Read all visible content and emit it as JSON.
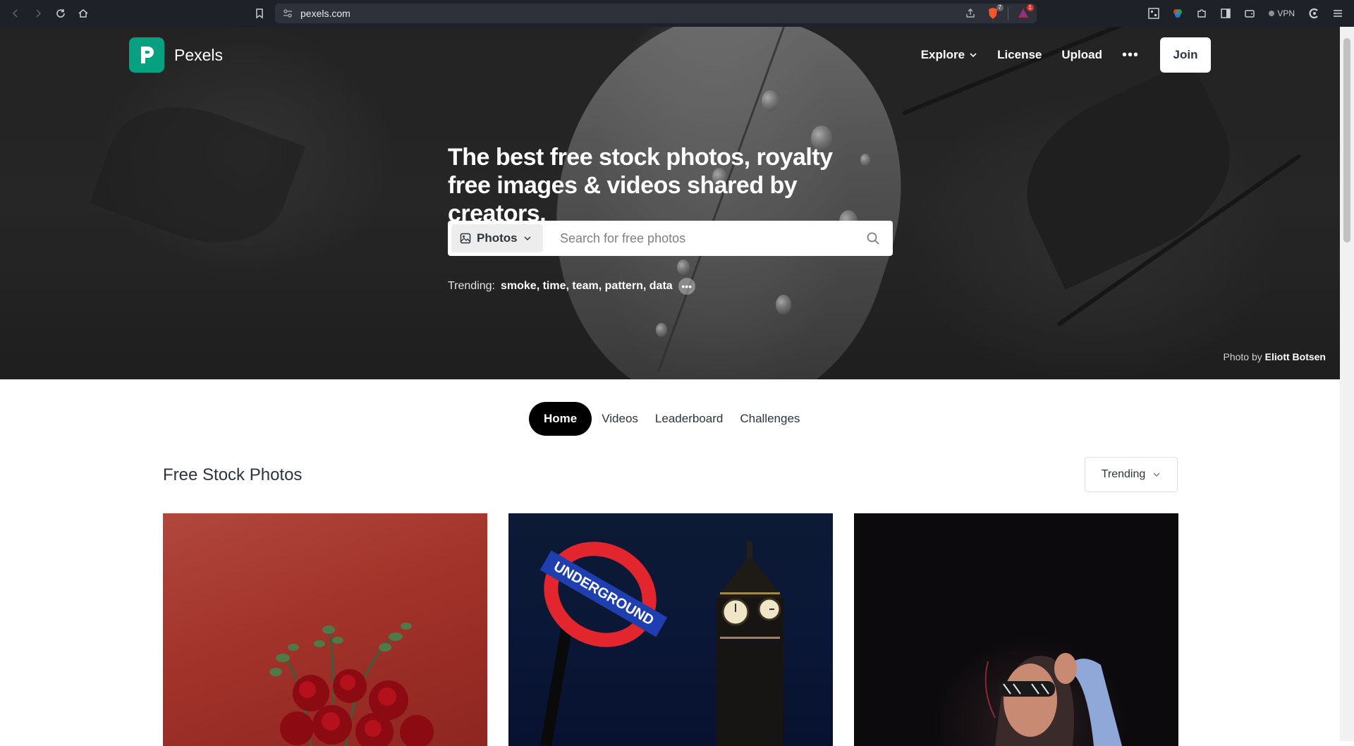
{
  "browser": {
    "url": "pexels.com",
    "vpn_label": "VPN",
    "brave_badge": "7",
    "rewards_badge": "1"
  },
  "header": {
    "brand": "Pexels",
    "menu": {
      "explore": "Explore",
      "license": "License",
      "upload": "Upload",
      "join": "Join"
    }
  },
  "hero": {
    "headline": "The best free stock photos, royalty free images & videos shared by creators.",
    "search": {
      "type_label": "Photos",
      "placeholder": "Search for free photos"
    },
    "trending": {
      "label": "Trending:",
      "terms": [
        "smoke",
        "time",
        "team",
        "pattern",
        "data"
      ]
    },
    "credit": {
      "prefix": "Photo by",
      "author": "Eliott Botsen"
    }
  },
  "tabs": [
    "Home",
    "Videos",
    "Leaderboard",
    "Challenges"
  ],
  "section": {
    "title": "Free Stock Photos",
    "sort_label": "Trending"
  },
  "photos": [
    {
      "subject": "roses"
    },
    {
      "subject": "london underground"
    },
    {
      "subject": "woman with sunglasses"
    }
  ],
  "colors": {
    "brand": "#07a081",
    "browser_bar": "#1f2129",
    "text_dark": "#2c343e"
  }
}
